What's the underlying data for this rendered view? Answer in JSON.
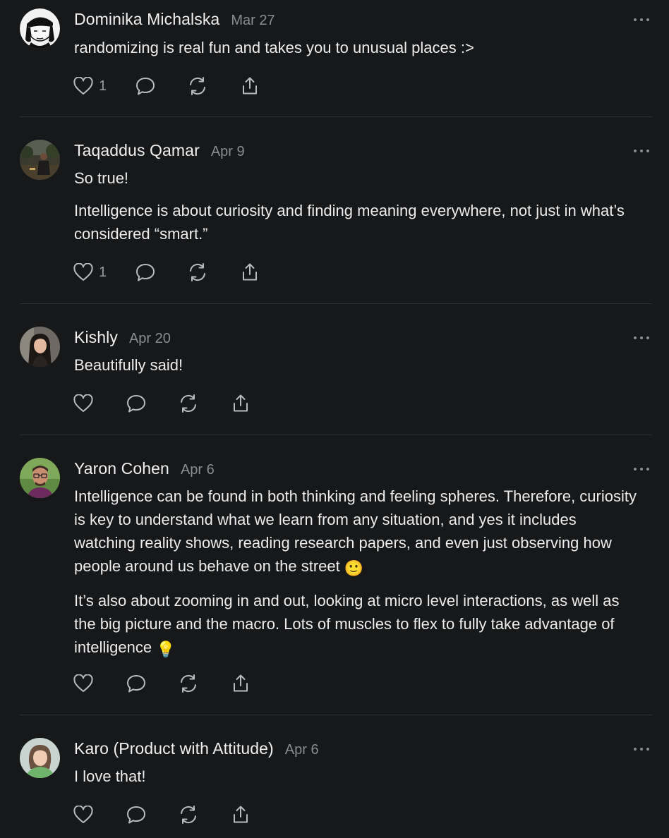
{
  "comments": [
    {
      "author": "Dominika Michalska",
      "date": "Mar 27",
      "paragraphs": [
        "randomizing is real fun and takes you to unusual places :>"
      ],
      "likes": "1",
      "avatar_icon": "sketch-portrait-avatar"
    },
    {
      "author": "Taqaddus Qamar",
      "date": "Apr 9",
      "paragraphs": [
        "So true!",
        "Intelligence is about curiosity and finding meaning everywhere, not just in what’s considered “smart.”"
      ],
      "likes": "1",
      "avatar_icon": "photo-avatar-outdoor"
    },
    {
      "author": "Kishly",
      "date": "Apr 20",
      "paragraphs": [
        "Beautifully said!"
      ],
      "likes": "",
      "avatar_icon": "photo-avatar-woman"
    },
    {
      "author": "Yaron Cohen",
      "date": "Apr 6",
      "paragraphs": [
        "Intelligence can be found in both thinking and feeling spheres. Therefore, curiosity is key to understand what we learn from any situation, and yes it includes watching reality shows, reading research papers, and even just observing how people around us behave on the street",
        "It’s also about zooming in and out, looking at micro level interactions, as well as the big picture and the macro. Lots of muscles to flex to fully take advantage of intelligence"
      ],
      "paragraph_emojis": [
        "🙂",
        "💡"
      ],
      "likes": "",
      "avatar_icon": "photo-avatar-man-glasses"
    },
    {
      "author": "Karo (Product with Attitude)",
      "date": "Apr 6",
      "paragraphs": [
        "I love that!"
      ],
      "likes": "",
      "avatar_icon": "photo-avatar-woman-green"
    }
  ],
  "colors": {
    "background": "#17181a",
    "text": "#ececec",
    "muted": "#8b8c8f",
    "divider": "#2d2e31"
  }
}
